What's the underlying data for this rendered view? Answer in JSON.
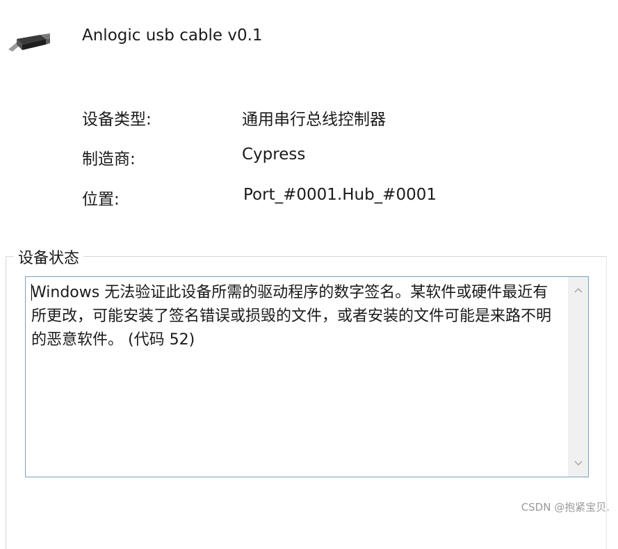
{
  "device": {
    "icon": "usb-cable-icon",
    "name": "Anlogic usb cable v0.1"
  },
  "properties": [
    {
      "label": "设备类型:",
      "value": "通用串行总线控制器"
    },
    {
      "label": "制造商:",
      "value": "Cypress"
    },
    {
      "label": "位置:",
      "value": "Port_#0001.Hub_#0001"
    }
  ],
  "status": {
    "group_label": "设备状态",
    "text": "Windows 无法验证此设备所需的驱动程序的数字签名。某软件或硬件最近有所更改，可能安装了签名错误或损毁的文件，或者安装的文件可能是来路不明的恶意软件。 (代码 52)"
  },
  "watermark": "CSDN @抱紧宝贝."
}
